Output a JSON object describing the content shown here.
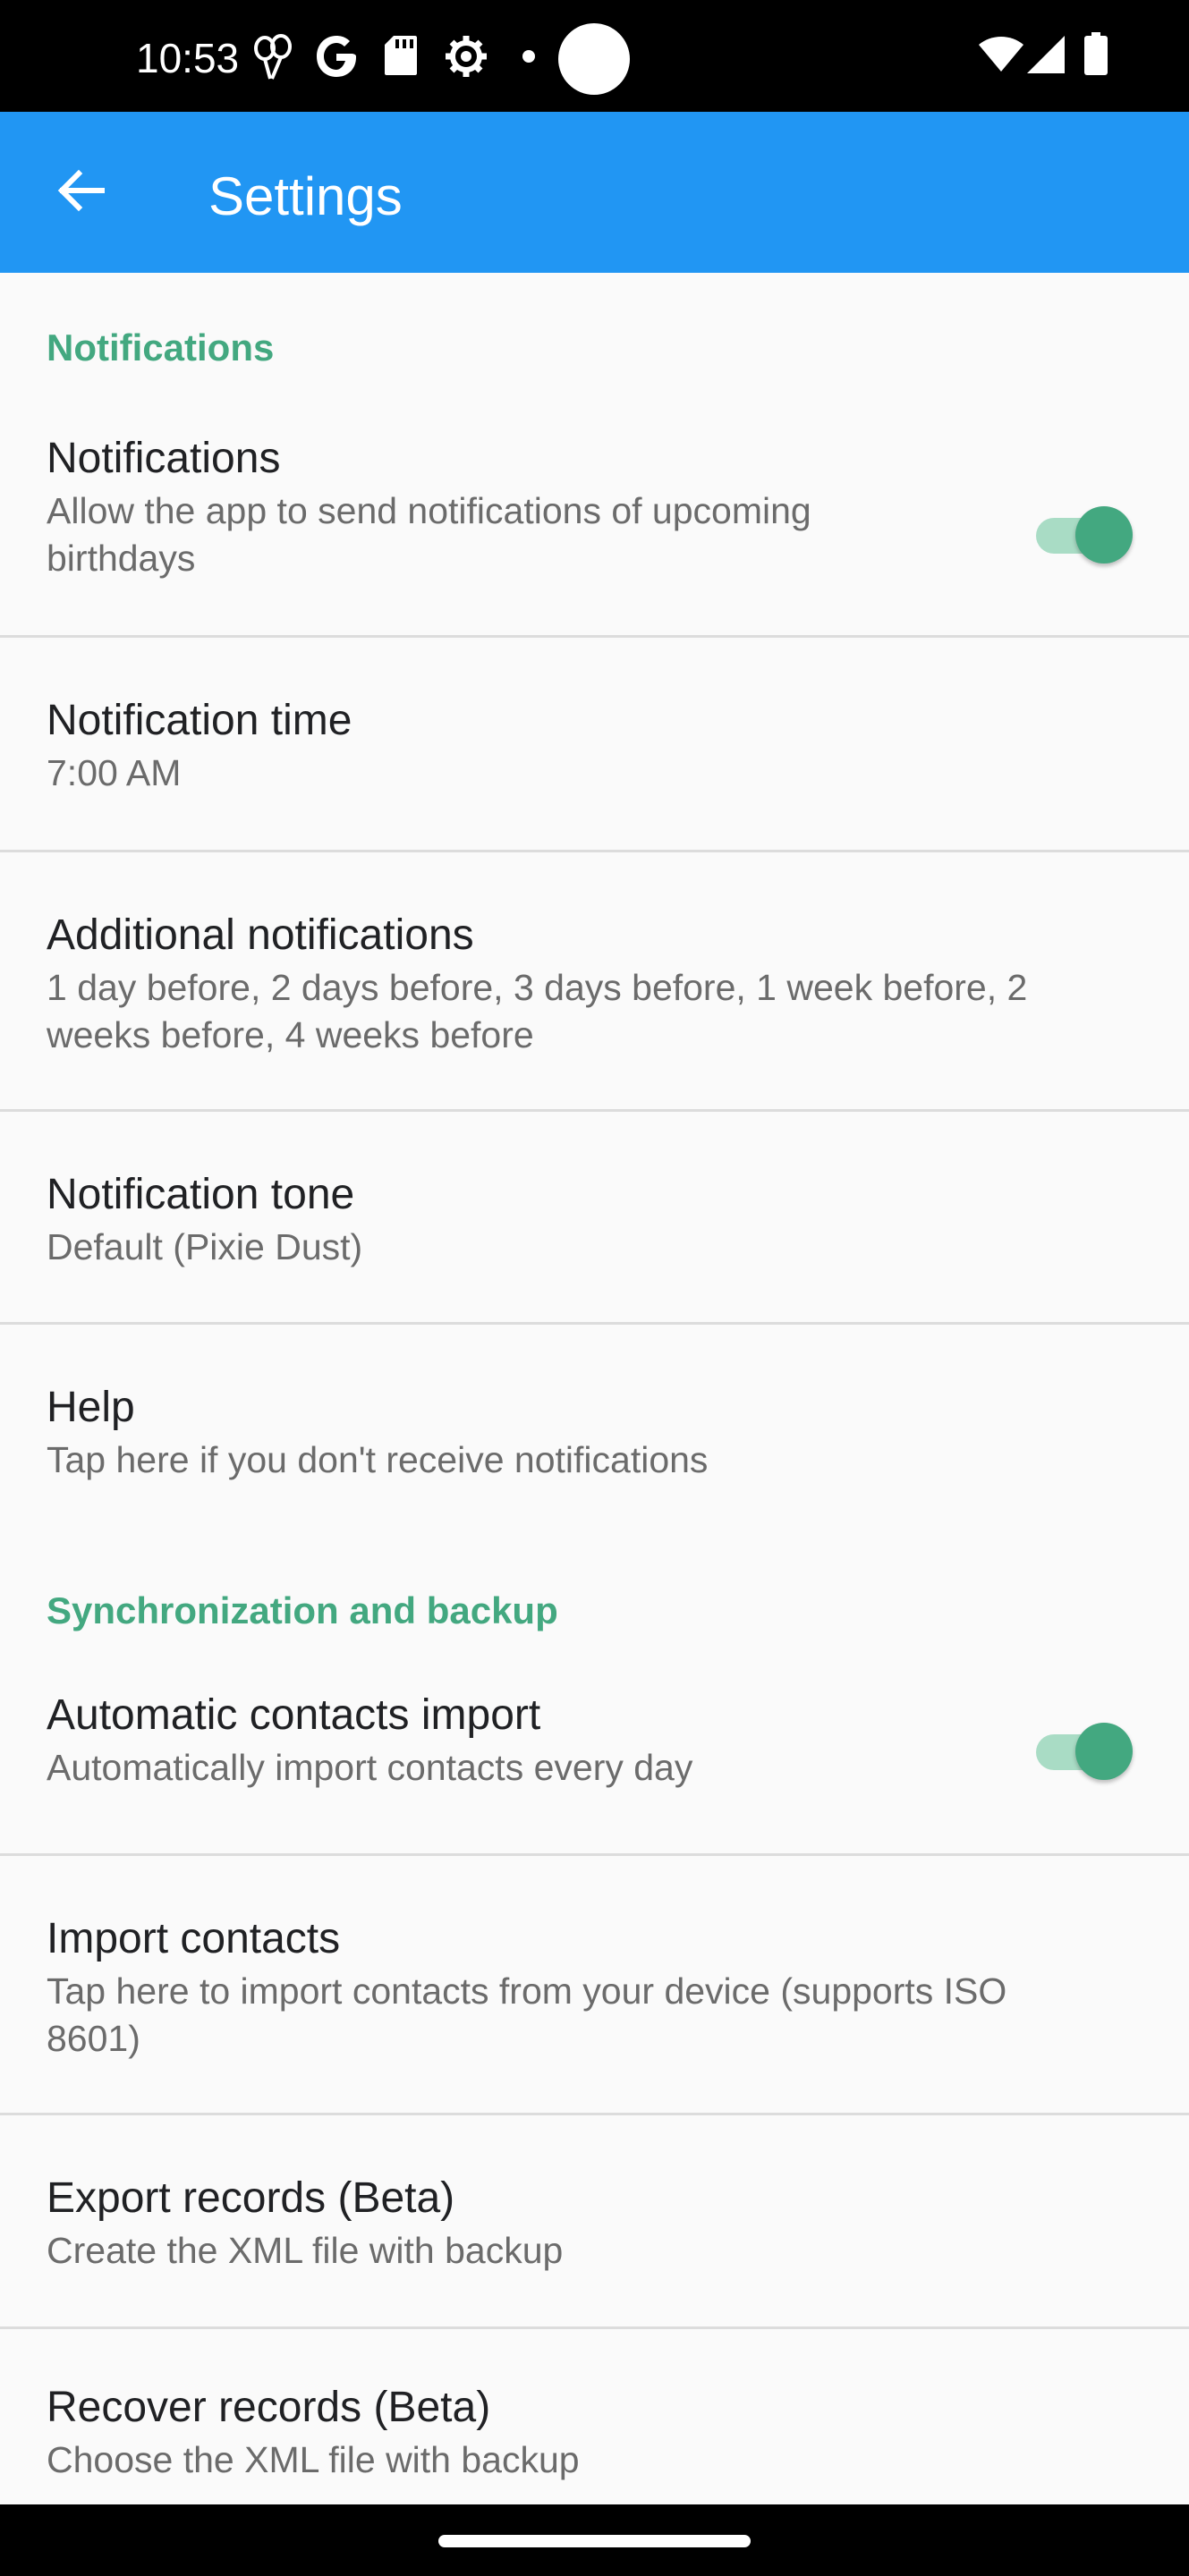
{
  "status_bar": {
    "time": "10:53",
    "icons": [
      "balloons-icon",
      "google-icon",
      "sd-card-icon",
      "settings-gear-icon",
      "notification-dot-icon",
      "wifi-icon",
      "signal-icon",
      "battery-icon"
    ]
  },
  "app_bar": {
    "title": "Settings",
    "back_icon": "arrow-back-icon",
    "background": "#2196f3"
  },
  "accent_color": "#43a880",
  "sections": [
    {
      "header": "Notifications",
      "items": [
        {
          "title": "Notifications",
          "summary": "Allow the app to send notifications of upcoming birthdays",
          "switch_on": true
        },
        {
          "title": "Notification time",
          "summary": "7:00 AM"
        },
        {
          "title": "Additional notifications",
          "summary": "1 day before, 2 days before, 3 days before, 1 week before, 2 weeks before, 4 weeks before"
        },
        {
          "title": "Notification tone",
          "summary": "Default (Pixie Dust)"
        },
        {
          "title": "Help",
          "summary": "Tap here if you don't receive notifications"
        }
      ]
    },
    {
      "header": "Synchronization and backup",
      "items": [
        {
          "title": "Automatic contacts import",
          "summary": "Automatically import contacts every day",
          "switch_on": true
        },
        {
          "title": "Import contacts",
          "summary": "Tap here to import contacts from your device (supports ISO 8601)"
        },
        {
          "title": "Export records (Beta)",
          "summary": "Create the XML file with backup"
        },
        {
          "title": "Recover records (Beta)",
          "summary": "Choose the XML file with backup"
        }
      ]
    }
  ]
}
